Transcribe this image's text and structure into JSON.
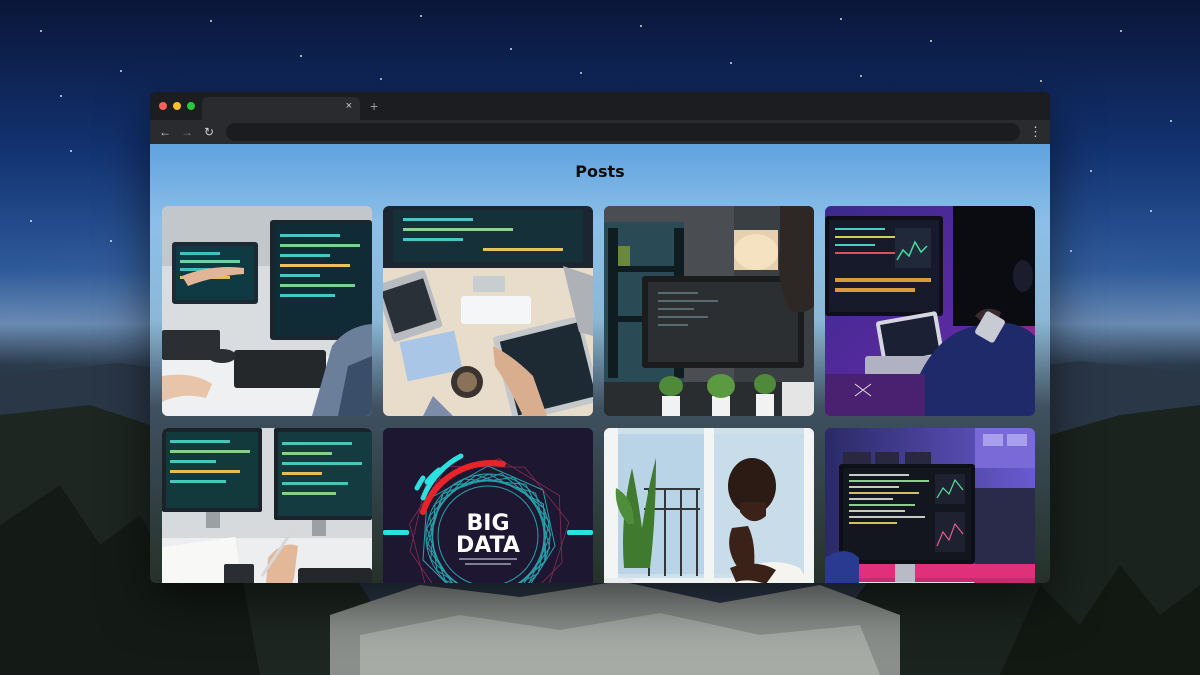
{
  "browser": {
    "tab_close_icon": "close-icon",
    "new_tab_icon": "plus-icon",
    "tab_close_glyph": "×",
    "new_tab_glyph": "+",
    "back_glyph": "←",
    "forward_glyph": "→",
    "reload_glyph": "↻",
    "menu_glyph": "⋮"
  },
  "page": {
    "title": "Posts"
  },
  "posts": [
    {
      "image": "coworkers-pointing-at-code-monitors"
    },
    {
      "image": "overhead-desk-with-monitor-and-keyboard"
    },
    {
      "image": "person-at-dark-monitor-in-plant-room"
    },
    {
      "image": "neon-lit-developer-workstation"
    },
    {
      "image": "hand-with-pen-at-code-monitors"
    },
    {
      "image": "big-data-graphic",
      "text_line1": "BIG",
      "text_line2": "DATA"
    },
    {
      "image": "man-thinking-by-window"
    },
    {
      "image": "monitor-with-terminal-purple-light"
    }
  ],
  "colors": {
    "page_top": "#5fa2df",
    "accent_cyan": "#2de0e0",
    "accent_red": "#e8242a",
    "neon_pink": "#e0307a",
    "neon_purple": "#6a3ad8"
  }
}
